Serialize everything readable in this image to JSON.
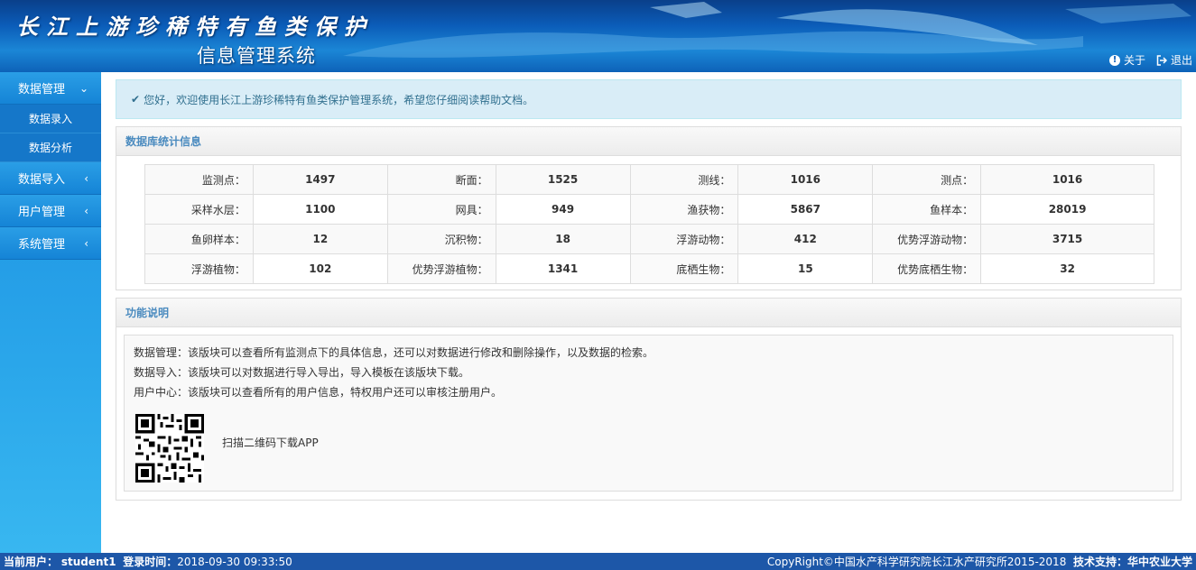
{
  "header": {
    "brand_title": "长江上游珍稀特有鱼类保护",
    "brand_subtitle": "信息管理系统",
    "about_label": "关于",
    "logout_label": "退出"
  },
  "sidebar": {
    "items": [
      {
        "label": "数据管理",
        "expanded": true,
        "icon": "chevron-down-icon",
        "children": [
          "数据录入",
          "数据分析"
        ]
      },
      {
        "label": "数据导入",
        "icon": "chevron-left-icon"
      },
      {
        "label": "用户管理",
        "icon": "chevron-left-icon"
      },
      {
        "label": "系统管理",
        "icon": "chevron-left-icon"
      }
    ]
  },
  "alert": {
    "text": "您好，欢迎使用长江上游珍稀特有鱼类保护管理系统，希望您仔细阅读帮助文档。"
  },
  "stats": {
    "title": "数据库统计信息",
    "rows": [
      [
        {
          "label": "监测点：",
          "value": "1497"
        },
        {
          "label": "断面：",
          "value": "1525"
        },
        {
          "label": "测线：",
          "value": "1016"
        },
        {
          "label": "测点：",
          "value": "1016"
        }
      ],
      [
        {
          "label": "采样水层：",
          "value": "1100"
        },
        {
          "label": "网具：",
          "value": "949"
        },
        {
          "label": "渔获物：",
          "value": "5867"
        },
        {
          "label": "鱼样本：",
          "value": "28019"
        }
      ],
      [
        {
          "label": "鱼卵样本：",
          "value": "12"
        },
        {
          "label": "沉积物：",
          "value": "18"
        },
        {
          "label": "浮游动物：",
          "value": "412"
        },
        {
          "label": "优势浮游动物：",
          "value": "3715"
        }
      ],
      [
        {
          "label": "浮游植物：",
          "value": "102"
        },
        {
          "label": "优势浮游植物：",
          "value": "1341"
        },
        {
          "label": "底栖生物：",
          "value": "15"
        },
        {
          "label": "优势底栖生物：",
          "value": "32"
        }
      ]
    ]
  },
  "functions": {
    "title": "功能说明",
    "lines": [
      "数据管理：该版块可以查看所有监测点下的具体信息，还可以对数据进行修改和删除操作，以及数据的检索。",
      "数据导入：该版块可以对数据进行导入导出，导入模板在该版块下载。",
      "用户中心：该版块可以查看所有的用户信息，特权用户还可以审核注册用户。"
    ],
    "qr_caption": "扫描二维码下载APP"
  },
  "footer": {
    "user_label": "当前用户：",
    "user_name": "student1",
    "login_label": "登录时间：",
    "login_time": "2018-09-30 09:33:50",
    "copyright": "CopyRight©中国水产科学研究院长江水产研究所2015-2018",
    "support_label": "技术支持：",
    "support_org": "华中农业大学"
  }
}
